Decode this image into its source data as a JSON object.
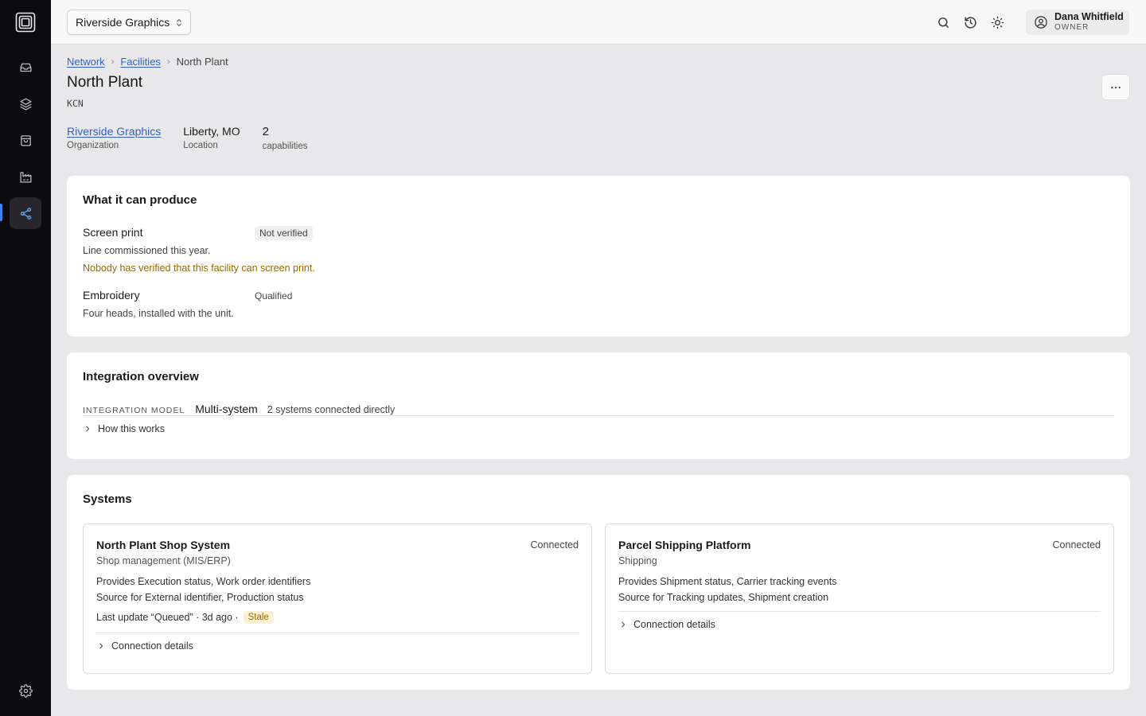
{
  "org_selector": {
    "label": "Riverside Graphics"
  },
  "user": {
    "name": "Dana Whitfield",
    "role": "OWNER"
  },
  "breadcrumb": [
    {
      "label": "Network"
    },
    {
      "label": "Facilities"
    },
    {
      "label": "North Plant"
    }
  ],
  "page": {
    "title": "North Plant",
    "code": "KCN"
  },
  "facts": {
    "organization": {
      "value": "Riverside Graphics",
      "label": "Organization"
    },
    "location": {
      "value": "Liberty, MO",
      "label": "Location"
    },
    "capabilities": {
      "value": "2",
      "label": "capabilities"
    }
  },
  "produce": {
    "title": "What it can produce",
    "items": [
      {
        "name": "Screen print",
        "status": "Not verified",
        "desc": "Line commissioned this year.",
        "warning": "Nobody has verified that this facility can screen print."
      },
      {
        "name": "Embroidery",
        "status": "Qualified",
        "desc": "Four heads, installed with the unit."
      }
    ]
  },
  "integration": {
    "title": "Integration overview",
    "model_label": "INTEGRATION MODEL",
    "model_value": "Multi-system",
    "model_desc": "2 systems connected directly",
    "how_label": "How this works"
  },
  "systems": {
    "title": "Systems",
    "items": [
      {
        "name": "North Plant Shop System",
        "status": "Connected",
        "type": "Shop management (MIS/ERP)",
        "provides": "Provides Execution status, Work order identifiers",
        "source": "Source for External identifier, Production status",
        "last_update": "Last update “Queued” · 3d ago ·",
        "stale": "Stale",
        "details_label": "Connection details"
      },
      {
        "name": "Parcel Shipping Platform",
        "status": "Connected",
        "type": "Shipping",
        "provides": "Provides Shipment status, Carrier tracking events",
        "source": "Source for Tracking updates, Shipment creation",
        "details_label": "Connection details"
      }
    ]
  },
  "colors": {
    "accent": "#3b82f6",
    "link": "#2f5fd0",
    "warning": "#9a6a00",
    "sidebar": "#0c0c0e"
  }
}
